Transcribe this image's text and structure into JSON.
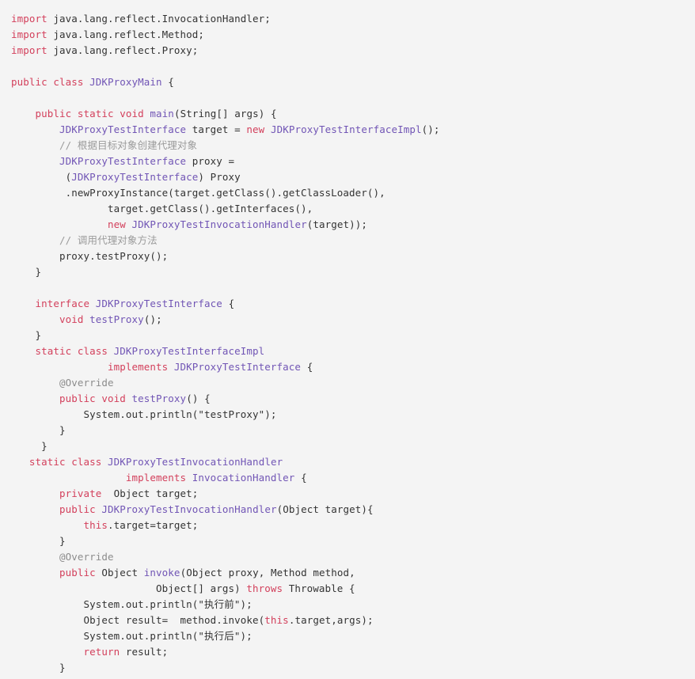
{
  "editor": {
    "language": "java",
    "background_color": "#f4f4f4",
    "default_text_color": "#333333",
    "keyword_color": "#d3405c",
    "type_color": "#7155b5",
    "comment_color": "#9b9b9b",
    "annotation_color": "#8c8c8c",
    "font_size_px": 12.5,
    "line_height_px": 20
  },
  "code": {
    "lines": [
      {
        "n": 1,
        "indent": "",
        "tokens": [
          {
            "t": "import",
            "c": "kw"
          },
          {
            "t": " java.lang.reflect.InvocationHandler;",
            "c": "txt"
          }
        ]
      },
      {
        "n": 2,
        "indent": "",
        "tokens": [
          {
            "t": "import",
            "c": "kw"
          },
          {
            "t": " java.lang.reflect.Method;",
            "c": "txt"
          }
        ]
      },
      {
        "n": 3,
        "indent": "",
        "tokens": [
          {
            "t": "import",
            "c": "kw"
          },
          {
            "t": " java.lang.reflect.Proxy;",
            "c": "txt"
          }
        ]
      },
      {
        "n": 4,
        "indent": "",
        "tokens": []
      },
      {
        "n": 5,
        "indent": "",
        "tokens": [
          {
            "t": "public class",
            "c": "kw"
          },
          {
            "t": " ",
            "c": "txt"
          },
          {
            "t": "JDKProxyMain",
            "c": "type"
          },
          {
            "t": " {",
            "c": "txt"
          }
        ]
      },
      {
        "n": 6,
        "indent": "",
        "tokens": []
      },
      {
        "n": 7,
        "indent": "    ",
        "tokens": [
          {
            "t": "public static void",
            "c": "kw"
          },
          {
            "t": " ",
            "c": "txt"
          },
          {
            "t": "main",
            "c": "type"
          },
          {
            "t": "(String[] args) {",
            "c": "txt"
          }
        ]
      },
      {
        "n": 8,
        "indent": "        ",
        "tokens": [
          {
            "t": "JDKProxyTestInterface",
            "c": "type"
          },
          {
            "t": " target = ",
            "c": "txt"
          },
          {
            "t": "new",
            "c": "kw"
          },
          {
            "t": " ",
            "c": "txt"
          },
          {
            "t": "JDKProxyTestInterfaceImpl",
            "c": "type"
          },
          {
            "t": "();",
            "c": "txt"
          }
        ]
      },
      {
        "n": 9,
        "indent": "        ",
        "tokens": [
          {
            "t": "// 根据目标对象创建代理对象",
            "c": "cmt"
          }
        ]
      },
      {
        "n": 10,
        "indent": "        ",
        "tokens": [
          {
            "t": "JDKProxyTestInterface",
            "c": "type"
          },
          {
            "t": " proxy =",
            "c": "txt"
          }
        ]
      },
      {
        "n": 11,
        "indent": "         ",
        "tokens": [
          {
            "t": "(",
            "c": "txt"
          },
          {
            "t": "JDKProxyTestInterface",
            "c": "type"
          },
          {
            "t": ") Proxy",
            "c": "txt"
          }
        ]
      },
      {
        "n": 12,
        "indent": "         ",
        "tokens": [
          {
            "t": ".newProxyInstance(target.getClass().getClassLoader(),",
            "c": "txt"
          }
        ]
      },
      {
        "n": 13,
        "indent": "                ",
        "tokens": [
          {
            "t": "target.getClass().getInterfaces(),",
            "c": "txt"
          }
        ]
      },
      {
        "n": 14,
        "indent": "                ",
        "tokens": [
          {
            "t": "new",
            "c": "kw"
          },
          {
            "t": " ",
            "c": "txt"
          },
          {
            "t": "JDKProxyTestInvocationHandler",
            "c": "type"
          },
          {
            "t": "(target));",
            "c": "txt"
          }
        ]
      },
      {
        "n": 15,
        "indent": "        ",
        "tokens": [
          {
            "t": "// 调用代理对象方法",
            "c": "cmt"
          }
        ]
      },
      {
        "n": 16,
        "indent": "        ",
        "tokens": [
          {
            "t": "proxy.testProxy();",
            "c": "txt"
          }
        ]
      },
      {
        "n": 17,
        "indent": "    ",
        "tokens": [
          {
            "t": "}",
            "c": "txt"
          }
        ]
      },
      {
        "n": 18,
        "indent": "",
        "tokens": []
      },
      {
        "n": 19,
        "indent": "    ",
        "tokens": [
          {
            "t": "interface",
            "c": "kw"
          },
          {
            "t": " ",
            "c": "txt"
          },
          {
            "t": "JDKProxyTestInterface",
            "c": "type"
          },
          {
            "t": " {",
            "c": "txt"
          }
        ]
      },
      {
        "n": 20,
        "indent": "        ",
        "tokens": [
          {
            "t": "void",
            "c": "kw"
          },
          {
            "t": " ",
            "c": "txt"
          },
          {
            "t": "testProxy",
            "c": "type"
          },
          {
            "t": "();",
            "c": "txt"
          }
        ]
      },
      {
        "n": 21,
        "indent": "    ",
        "tokens": [
          {
            "t": "}",
            "c": "txt"
          }
        ]
      },
      {
        "n": 22,
        "indent": "    ",
        "tokens": [
          {
            "t": "static class",
            "c": "kw"
          },
          {
            "t": " ",
            "c": "txt"
          },
          {
            "t": "JDKProxyTestInterfaceImpl",
            "c": "type"
          }
        ]
      },
      {
        "n": 23,
        "indent": "                ",
        "tokens": [
          {
            "t": "implements",
            "c": "kw"
          },
          {
            "t": " ",
            "c": "txt"
          },
          {
            "t": "JDKProxyTestInterface",
            "c": "type"
          },
          {
            "t": " {",
            "c": "txt"
          }
        ]
      },
      {
        "n": 24,
        "indent": "        ",
        "tokens": [
          {
            "t": "@Override",
            "c": "ann"
          }
        ]
      },
      {
        "n": 25,
        "indent": "        ",
        "tokens": [
          {
            "t": "public void",
            "c": "kw"
          },
          {
            "t": " ",
            "c": "txt"
          },
          {
            "t": "testProxy",
            "c": "type"
          },
          {
            "t": "() {",
            "c": "txt"
          }
        ]
      },
      {
        "n": 26,
        "indent": "            ",
        "tokens": [
          {
            "t": "System.out.println(\"testProxy\");",
            "c": "txt"
          }
        ]
      },
      {
        "n": 27,
        "indent": "        ",
        "tokens": [
          {
            "t": "}",
            "c": "txt"
          }
        ]
      },
      {
        "n": 28,
        "indent": "     ",
        "tokens": [
          {
            "t": "}",
            "c": "txt"
          }
        ]
      },
      {
        "n": 29,
        "indent": "   ",
        "tokens": [
          {
            "t": "static class",
            "c": "kw"
          },
          {
            "t": " ",
            "c": "txt"
          },
          {
            "t": "JDKProxyTestInvocationHandler",
            "c": "type"
          }
        ]
      },
      {
        "n": 30,
        "indent": "                   ",
        "tokens": [
          {
            "t": "implements",
            "c": "kw"
          },
          {
            "t": " ",
            "c": "txt"
          },
          {
            "t": "InvocationHandler",
            "c": "type"
          },
          {
            "t": " {",
            "c": "txt"
          }
        ]
      },
      {
        "n": 31,
        "indent": "        ",
        "tokens": [
          {
            "t": "private",
            "c": "kw"
          },
          {
            "t": "  Object target;",
            "c": "txt"
          }
        ]
      },
      {
        "n": 32,
        "indent": "        ",
        "tokens": [
          {
            "t": "public",
            "c": "kw"
          },
          {
            "t": " ",
            "c": "txt"
          },
          {
            "t": "JDKProxyTestInvocationHandler",
            "c": "type"
          },
          {
            "t": "(Object target){",
            "c": "txt"
          }
        ]
      },
      {
        "n": 33,
        "indent": "            ",
        "tokens": [
          {
            "t": "this",
            "c": "kw"
          },
          {
            "t": ".target=target;",
            "c": "txt"
          }
        ]
      },
      {
        "n": 34,
        "indent": "        ",
        "tokens": [
          {
            "t": "}",
            "c": "txt"
          }
        ]
      },
      {
        "n": 35,
        "indent": "        ",
        "tokens": [
          {
            "t": "@Override",
            "c": "ann"
          }
        ]
      },
      {
        "n": 36,
        "indent": "        ",
        "tokens": [
          {
            "t": "public",
            "c": "kw"
          },
          {
            "t": " Object ",
            "c": "txt"
          },
          {
            "t": "invoke",
            "c": "type"
          },
          {
            "t": "(Object proxy, Method method,",
            "c": "txt"
          }
        ]
      },
      {
        "n": 37,
        "indent": "                        ",
        "tokens": [
          {
            "t": "Object[] args) ",
            "c": "txt"
          },
          {
            "t": "throws",
            "c": "kw"
          },
          {
            "t": " Throwable {",
            "c": "txt"
          }
        ]
      },
      {
        "n": 38,
        "indent": "            ",
        "tokens": [
          {
            "t": "System.out.println(\"执行前\");",
            "c": "txt"
          }
        ]
      },
      {
        "n": 39,
        "indent": "            ",
        "tokens": [
          {
            "t": "Object result=  method.invoke(",
            "c": "txt"
          },
          {
            "t": "this",
            "c": "kw"
          },
          {
            "t": ".target,args);",
            "c": "txt"
          }
        ]
      },
      {
        "n": 40,
        "indent": "            ",
        "tokens": [
          {
            "t": "System.out.println(\"执行后\");",
            "c": "txt"
          }
        ]
      },
      {
        "n": 41,
        "indent": "            ",
        "tokens": [
          {
            "t": "return",
            "c": "kw"
          },
          {
            "t": " result;",
            "c": "txt"
          }
        ]
      },
      {
        "n": 42,
        "indent": "        ",
        "tokens": [
          {
            "t": "}",
            "c": "txt"
          }
        ]
      }
    ]
  }
}
